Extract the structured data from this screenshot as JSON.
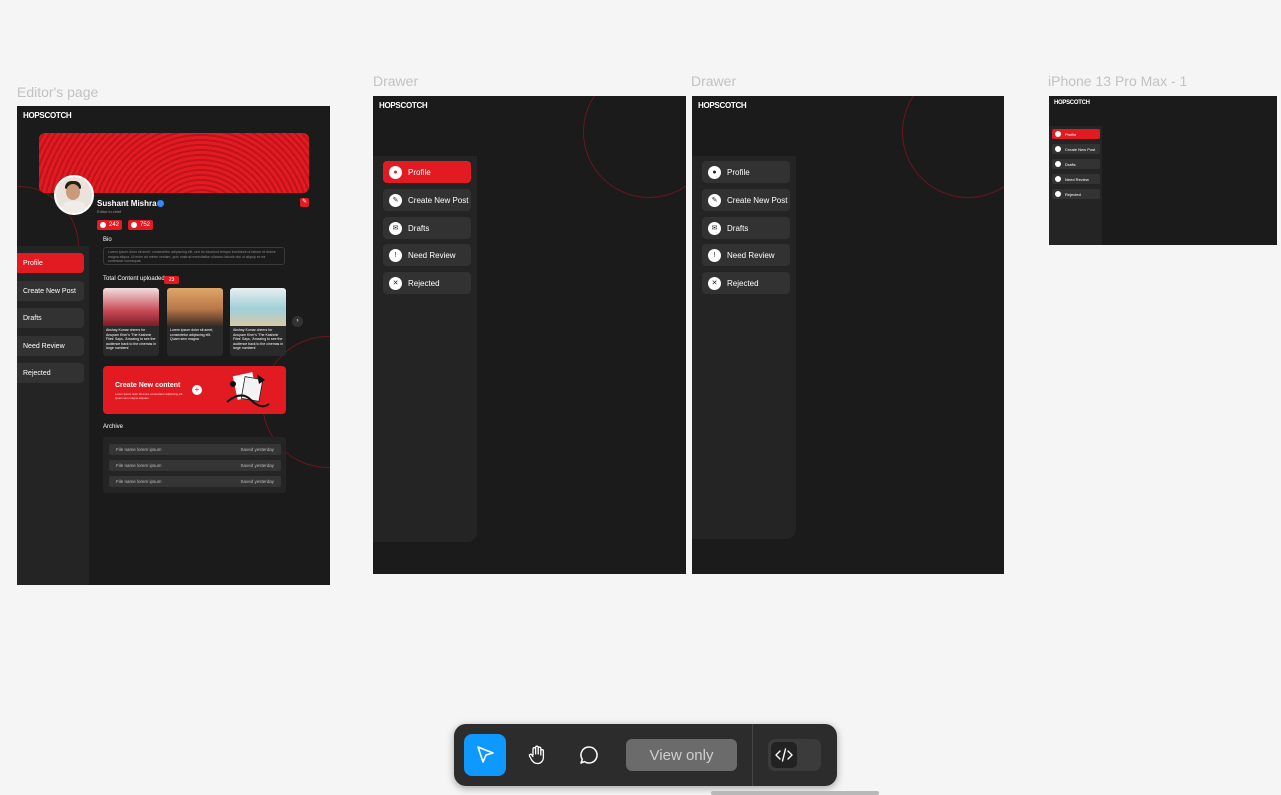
{
  "frames": {
    "editor": {
      "label": "Editor's page",
      "logo": "HOPSCOTCH",
      "profile": {
        "name": "Sushant Mishra",
        "role": "Editor in chief",
        "stat1": "242",
        "stat2": "752"
      },
      "bio": {
        "title": "Bio",
        "text": "Lorem ipsum dolor sit amet, consectetur adipiscing elit, sed do eiusmod tempor incididunt ut labore et dolore magna aliqua. Ut enim ad minim veniam, quis nostrud exercitation ullamco laboris nisi ut aliquip ex ea commodo consequat."
      },
      "menu": [
        "Profile",
        "Create New Post",
        "Drafts",
        "Need Review",
        "Rejected"
      ],
      "content": {
        "title": "Total Content uploaded",
        "count": "23",
        "cards": [
          "Akshay Kumar cheers for Anupam Kher's 'The Kashmir Files' Says, 'Amazing to see the audience back to the cinemas in large numbers'",
          "Lorem ipsum dolor sit amet, consectetur adipiscing elit. Quam sem magna",
          "Akshay Kumar cheers for Anupam Kher's 'The Kashmir Files' Says, 'Amazing to see the audience back to the cinemas in large numbers'"
        ]
      },
      "cta": {
        "title": "Create New content",
        "subtitle": "Lorem ipsum dolor sit amet, consectetur adipiscing elit. Quam sem magna aliquam."
      },
      "archive": {
        "title": "Archive",
        "rows": [
          {
            "name": "File name lorem ipsum",
            "status": "Saved yesterday"
          },
          {
            "name": "File name lorem ipsum",
            "status": "Saved yesterday"
          },
          {
            "name": "File name lorem ipsum",
            "status": "Saved yesterday"
          }
        ]
      }
    },
    "drawer1": {
      "label": "Drawer",
      "logo": "HOPSCOTCH",
      "menu": [
        "Profile",
        "Create New Post",
        "Drafts",
        "Need Review",
        "Rejected"
      ]
    },
    "drawer2": {
      "label": "Drawer",
      "logo": "HOPSCOTCH",
      "menu": [
        "Profile",
        "Create New Post",
        "Drafts",
        "Need Review",
        "Rejected"
      ]
    },
    "iphone": {
      "label": "iPhone 13 Pro Max - 1",
      "logo": "HOPSCOTCH",
      "menu": [
        "Profile",
        "Create New Post",
        "Drafts",
        "Need Review",
        "Rejected"
      ]
    }
  },
  "toolbar": {
    "tools": [
      "move-icon",
      "hand-icon",
      "comment-icon"
    ],
    "view_only": "View only",
    "dev_mode": "code-icon"
  },
  "colors": {
    "accent": "#e21b23",
    "tool_active": "#0d99ff",
    "frame_bg": "#1b1b1b"
  }
}
